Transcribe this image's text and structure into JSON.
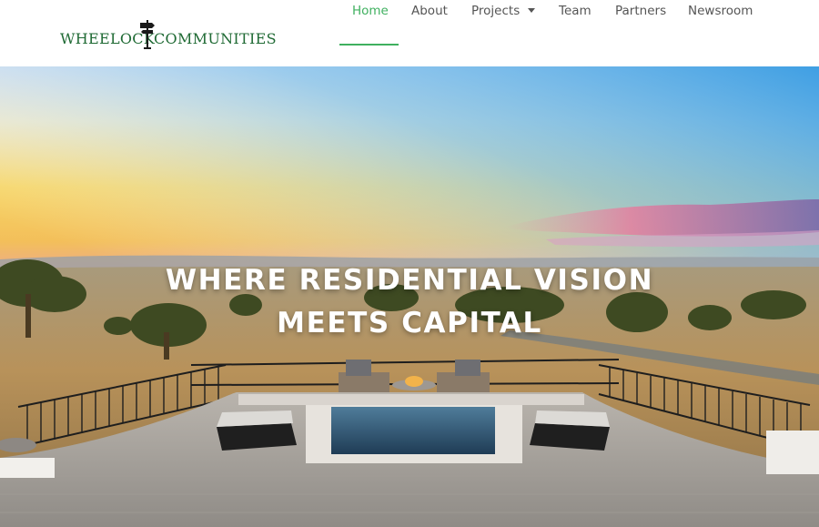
{
  "brand": {
    "logo_left": "WHEELOCK",
    "logo_right": "COMMUNITIES",
    "color": "#1f6a34"
  },
  "nav": {
    "items": [
      {
        "label": "Home",
        "active": true
      },
      {
        "label": "About"
      },
      {
        "label": "Projects",
        "has_dropdown": true
      },
      {
        "label": "Team"
      },
      {
        "label": "Partners"
      },
      {
        "label": "Newsroom"
      }
    ],
    "active_color": "#3fb05f",
    "text_color": "#555555"
  },
  "hero": {
    "title_line1": "WHERE RESIDENTIAL VISION",
    "title_line2": "MEETS CAPITAL"
  }
}
